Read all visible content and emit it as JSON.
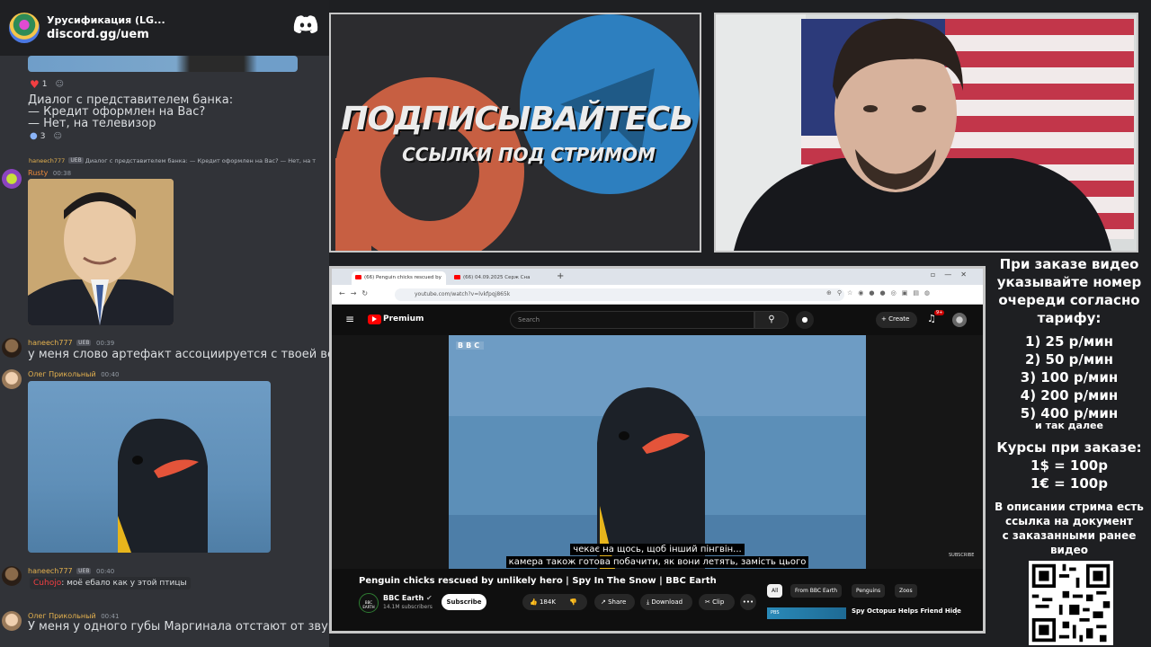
{
  "discord": {
    "server_title": "Урусификация (LG...",
    "invite_link": "discord.gg/uem",
    "reaction1_count": "1",
    "message1_lines": [
      "Диалог с представителем банка:",
      "— Кредит оформлен на Вас?",
      "— Нет, на телевизор"
    ],
    "reaction2_count": "3",
    "reply1": {
      "author": "haneech777",
      "badge": "UEB",
      "text": "Диалог с представителем банка:  — Кредит оформлен на Вас? — Нет, на т"
    },
    "rusty": {
      "name": "Rusty",
      "time": "00:38"
    },
    "msg3": {
      "name": "haneech777",
      "badge": "UEB",
      "time": "00:39",
      "text": "у меня слово артефакт ассоциируется с твоей вебкой"
    },
    "msg4": {
      "name": "Олег Прикольный",
      "time": "00:40"
    },
    "msg5": {
      "name": "haneech777",
      "badge": "UEB",
      "time": "00:40",
      "mention": "Cuhojo",
      "text": ": моё ебало как у этой птицы"
    },
    "msg6": {
      "name": "Олег Прикольный",
      "time": "00:41",
      "text": "У меня у одного губы Маргинала отстают от звука?"
    }
  },
  "promo": {
    "line1": "ПОДПИСЫВАЙТЕСЬ",
    "line2": "ССЫЛКИ ПОД СТРИМОМ"
  },
  "browser": {
    "tab1": "(66) Penguin chicks rescued by",
    "tab2": "(66) 04.09.2025 Серж Сна",
    "url": "youtube.com/watch?v=lvkfpqj865k",
    "yt_brand": "Premium",
    "search_placeholder": "Search",
    "create_label": "Create",
    "notif_count": "9+",
    "bbc_logo": "BBC",
    "subtitle_line1": "чекає на щось, щоб інший пінгвін...",
    "subtitle_line2": "камера також готова побачити, як вони летять, замість цього",
    "subscribe_watermark": "SUBSCRIBE",
    "video_title": "Penguin chicks rescued by unlikely hero | Spy In The Snow | BBC Earth",
    "channel_name": "BBC Earth",
    "channel_subs": "14.1M subscribers",
    "channel_logo_text": "BBC EARTH",
    "subscribe_btn": "Subscribe",
    "like_count": "184K",
    "share_label": "Share",
    "download_label": "Download",
    "clip_label": "Clip",
    "chips": [
      "All",
      "From BBC Earth",
      "Penguins",
      "Zoos"
    ],
    "rec_title": "Spy Octopus Helps Friend Hide",
    "rec_badge": "PBS"
  },
  "info": {
    "lines": [
      "При заказе видео",
      "указывайте номер",
      "очереди согласно",
      "тарифу:"
    ],
    "prices": [
      "1) 25 р/мин",
      "2) 50 р/мин",
      "3) 100 р/мин",
      "4) 200 р/мин",
      "5) 400 р/мин"
    ],
    "etc": "и так далее",
    "rates_title": "Курсы при заказе:",
    "rates": [
      "1$ = 100р",
      "1€ = 100р"
    ],
    "desc": [
      "В описании стрима есть",
      "ссылка на документ",
      "с заказанными ранее",
      "видео"
    ]
  },
  "colors": {
    "discord_bg": "#313338",
    "yt_red": "#ff0000",
    "subtitle_bg": "#000000"
  }
}
